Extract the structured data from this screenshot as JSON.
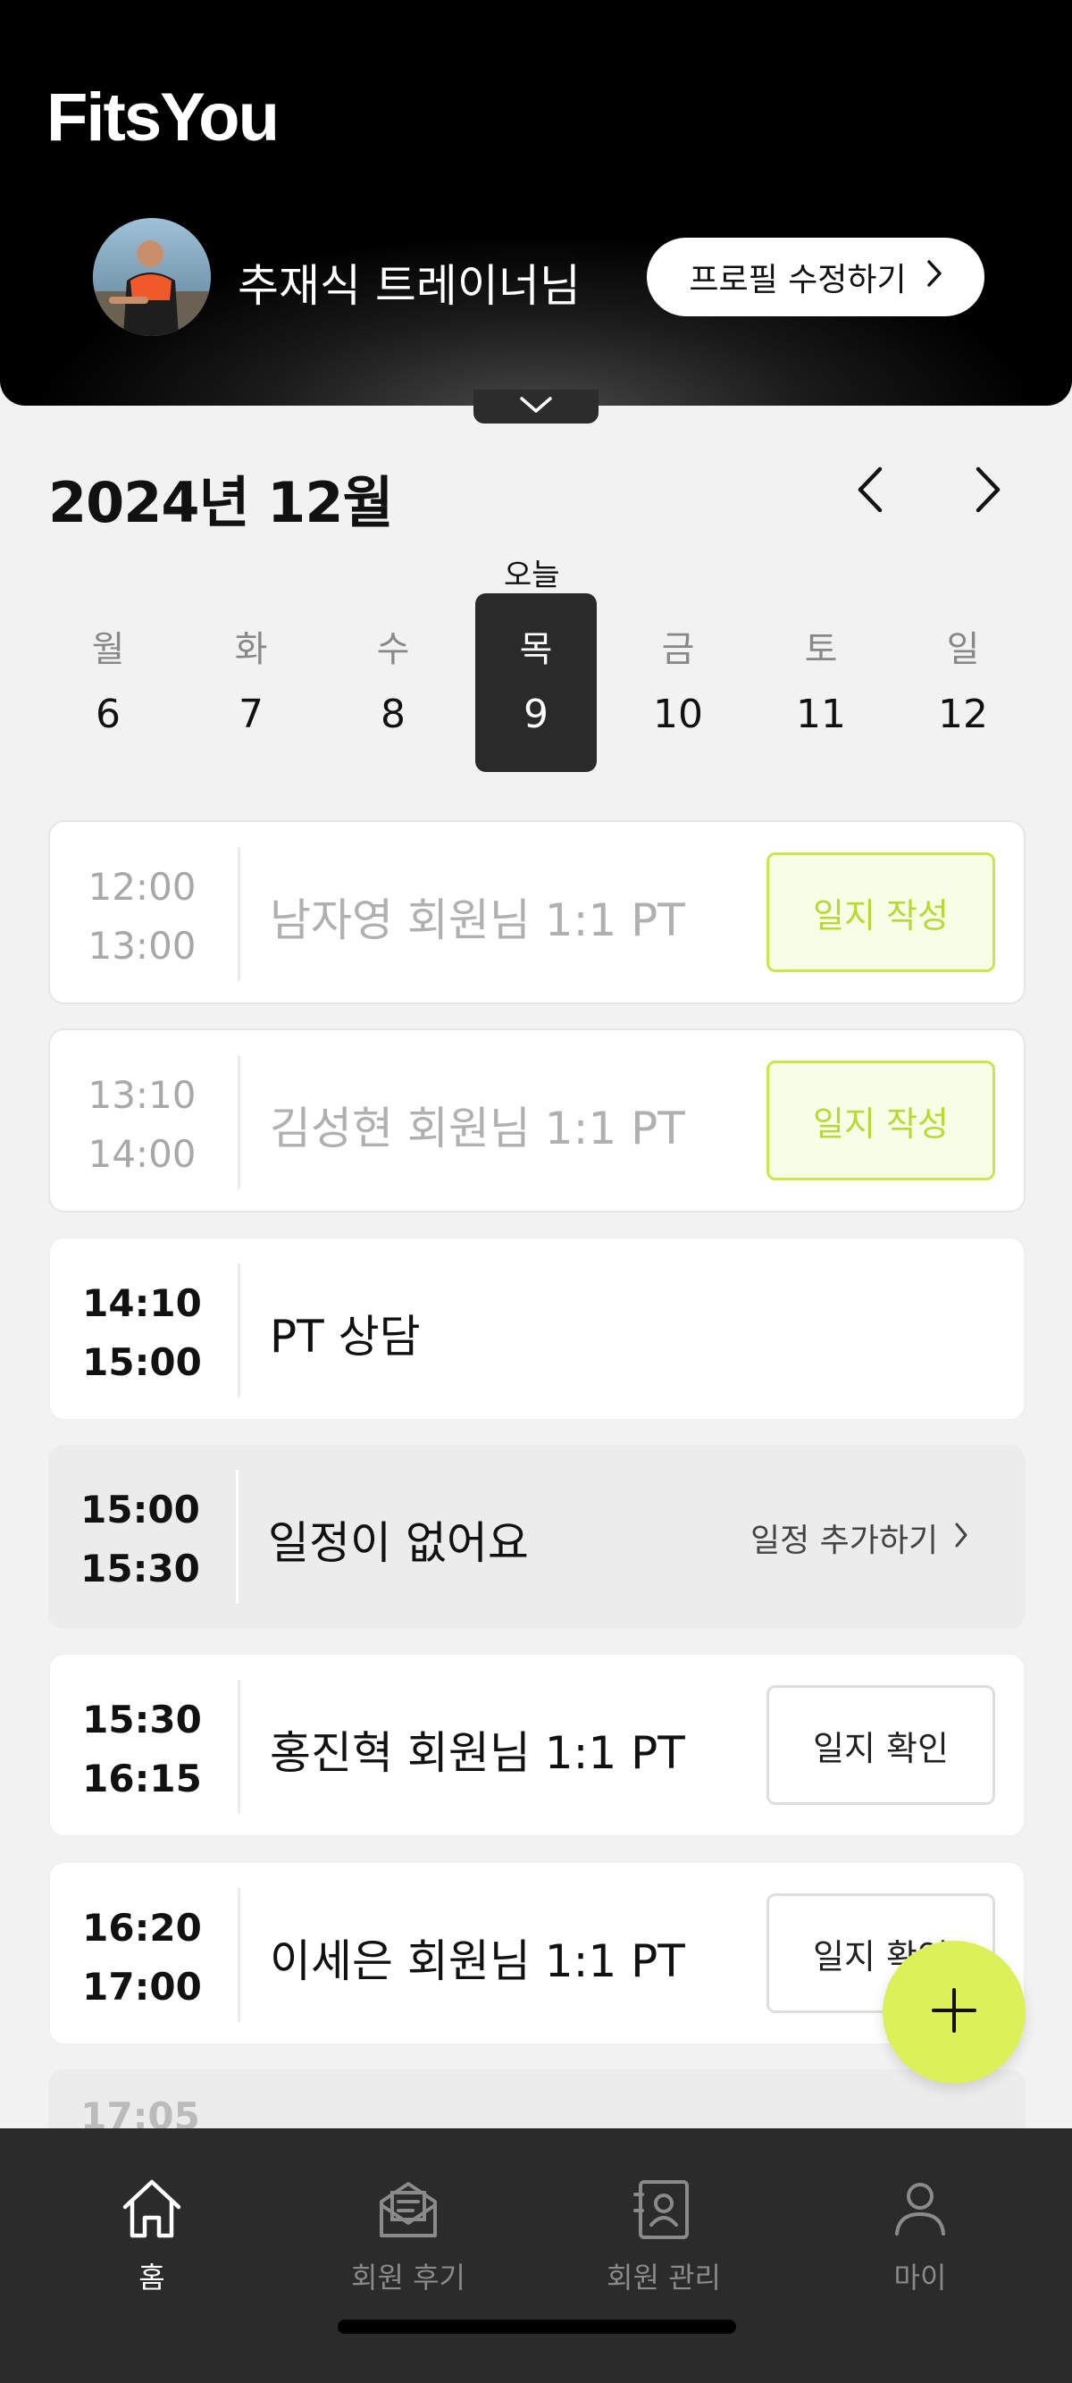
{
  "header": {
    "logo": "FitsYou",
    "trainer_name": "추재식 트레이너님",
    "profile_button": "프로필 수정하기"
  },
  "calendar": {
    "month_title": "2024년 12월",
    "today_label": "오늘",
    "days": [
      {
        "name": "월",
        "num": "6"
      },
      {
        "name": "화",
        "num": "7"
      },
      {
        "name": "수",
        "num": "8"
      },
      {
        "name": "목",
        "num": "9"
      },
      {
        "name": "금",
        "num": "10"
      },
      {
        "name": "토",
        "num": "11"
      },
      {
        "name": "일",
        "num": "12"
      }
    ]
  },
  "schedule": [
    {
      "start": "12:00",
      "end": "13:00",
      "title": "남자영 회원님 1:1 PT",
      "action": "일지 작성"
    },
    {
      "start": "13:10",
      "end": "14:00",
      "title": "김성현 회원님 1:1 PT",
      "action": "일지 작성"
    },
    {
      "start": "14:10",
      "end": "15:00",
      "title": "PT 상담"
    },
    {
      "start": "15:00",
      "end": "15:30",
      "title": "일정이 없어요",
      "action": "일정 추가하기"
    },
    {
      "start": "15:30",
      "end": "16:15",
      "title": "홍진혁 회원님 1:1 PT",
      "action": "일지 확인"
    },
    {
      "start": "16:20",
      "end": "17:00",
      "title": "이세은 회원님 1:1 PT",
      "action": "일지 확인"
    },
    {
      "start": "17:05"
    }
  ],
  "bottom_nav": [
    {
      "label": "홈"
    },
    {
      "label": "회원 후기"
    },
    {
      "label": "회원 관리"
    },
    {
      "label": "마이"
    }
  ],
  "colors": {
    "accent": "#dcf05a",
    "header_bg": "#000000",
    "nav_bg": "#2b2b2b"
  }
}
